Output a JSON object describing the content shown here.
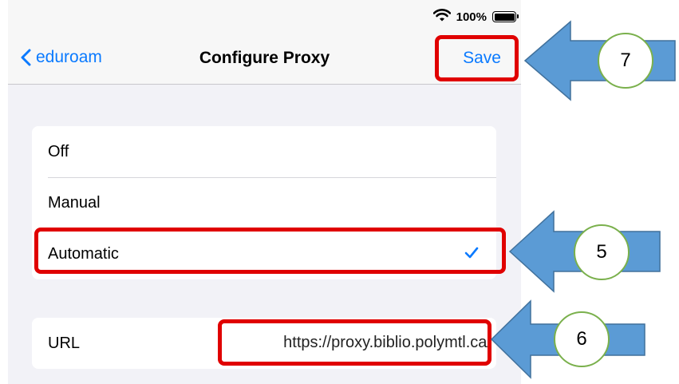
{
  "status_bar": {
    "battery_percent": "100%",
    "battery_level": 1.0
  },
  "nav": {
    "back_label": "eduroam",
    "title": "Configure Proxy",
    "save_label": "Save"
  },
  "proxy_options": {
    "off": "Off",
    "manual": "Manual",
    "automatic": "Automatic",
    "selected": "Automatic"
  },
  "url_row": {
    "label": "URL",
    "value": "https://proxy.biblio.polymtl.ca/"
  },
  "annotations": {
    "step_save": "7",
    "step_automatic": "5",
    "step_url": "6"
  },
  "colors": {
    "accent": "#0a7aff",
    "highlight": "#e00000",
    "arrow_fill": "#5b9bd5",
    "arrow_stroke": "#41719c",
    "badge_border": "#7ab04c"
  }
}
